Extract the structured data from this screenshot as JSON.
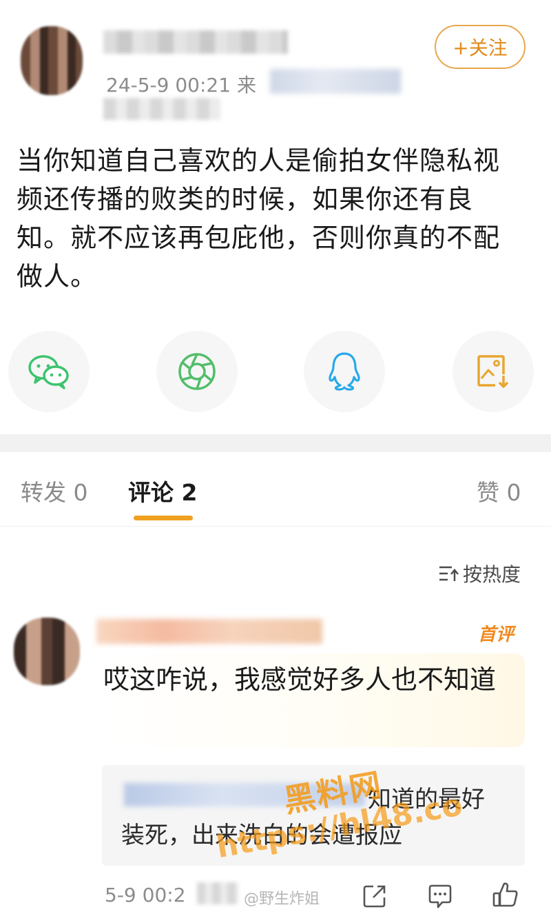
{
  "post": {
    "meta_time": "24-5-9 00:21  来",
    "follow_label": "+关注",
    "text": "当你知道自己喜欢的人是偷拍女伴隐私视频还传播的败类的时候，如果你还有良知。就不应该再包庇他，否则你真的不配做人。",
    "share": [
      "wechat-icon",
      "moments-icon",
      "qq-icon",
      "save-image-icon"
    ]
  },
  "colors": {
    "accent": "#f0a020",
    "wechat": "#3cc46e",
    "moments": "#52bd6a",
    "qq": "#27a9e8",
    "save": "#e8a630"
  },
  "tabs": {
    "repost": "转发 0",
    "comments": "评论 2",
    "likes": "赞 0"
  },
  "sort": {
    "label": "按热度"
  },
  "comment": {
    "badge": "首评",
    "text": "哎这咋说，我感觉好多人也不知道",
    "reply_line1": "知道的最好",
    "reply_line2": "装死，出来洗白的会遭报应",
    "time": "5-9 00:2",
    "platform_watermark": "@野生炸姐"
  },
  "watermark": {
    "title": "黑料网",
    "url": "https://hl48.co"
  }
}
